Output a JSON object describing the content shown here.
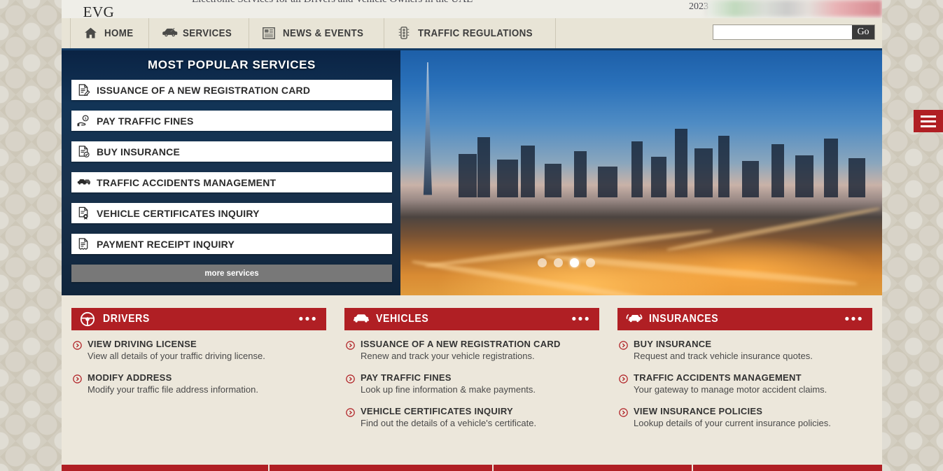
{
  "site": {
    "logo_text": "EVG",
    "tagline": "Electronic Services for all Drivers and Vehicle Owners in the UAE",
    "year": "2023"
  },
  "nav": {
    "items": [
      {
        "label": "HOME",
        "icon": "home-icon"
      },
      {
        "label": "SERVICES",
        "icon": "car-icon"
      },
      {
        "label": "NEWS & EVENTS",
        "icon": "newspaper-icon"
      },
      {
        "label": "TRAFFIC REGULATIONS",
        "icon": "traffic-light-icon"
      }
    ]
  },
  "search": {
    "value": "",
    "placeholder": "",
    "button_label": "Go"
  },
  "popular": {
    "title": "MOST POPULAR SERVICES",
    "items": [
      {
        "label": "ISSUANCE OF A NEW REGISTRATION CARD",
        "icon": "document-edit-icon"
      },
      {
        "label": "PAY TRAFFIC FINES",
        "icon": "hand-coin-icon"
      },
      {
        "label": "BUY INSURANCE",
        "icon": "document-check-icon"
      },
      {
        "label": "TRAFFIC ACCIDENTS MANAGEMENT",
        "icon": "car-collision-icon"
      },
      {
        "label": "VEHICLE CERTIFICATES INQUIRY",
        "icon": "certificate-icon"
      },
      {
        "label": "PAYMENT RECEIPT INQUIRY",
        "icon": "receipt-icon"
      }
    ],
    "more_label": "more services"
  },
  "carousel": {
    "slide_count": 4,
    "active_index": 2
  },
  "side_tab": {
    "icon": "hamburger-menu-icon"
  },
  "cards": [
    {
      "title": "DRIVERS",
      "icon": "steering-wheel-icon",
      "menu_icon": "ellipsis-icon",
      "items": [
        {
          "title": "VIEW DRIVING LICENSE",
          "desc": "View all details of your traffic driving license."
        },
        {
          "title": "MODIFY ADDRESS",
          "desc": "Modify your traffic file address information."
        }
      ]
    },
    {
      "title": "VEHICLES",
      "icon": "car-front-icon",
      "menu_icon": "ellipsis-icon",
      "items": [
        {
          "title": "ISSUANCE OF A NEW REGISTRATION CARD",
          "desc": "Renew and track your vehicle registrations."
        },
        {
          "title": "PAY TRAFFIC FINES",
          "desc": "Look up fine information & make payments."
        },
        {
          "title": "VEHICLE CERTIFICATES INQUIRY",
          "desc": "Find out the details of a vehicle's certificate."
        }
      ]
    },
    {
      "title": "INSURANCES",
      "icon": "car-shield-icon",
      "menu_icon": "ellipsis-icon",
      "items": [
        {
          "title": "BUY INSURANCE",
          "desc": "Request and track vehicle insurance quotes."
        },
        {
          "title": "TRAFFIC ACCIDENTS MANAGEMENT",
          "desc": "Your gateway to manage motor accident claims."
        },
        {
          "title": "VIEW INSURANCE POLICIES",
          "desc": "Lookup details of your current insurance policies."
        }
      ]
    }
  ],
  "colors": {
    "brand_red": "#b01f24",
    "nav_bg": "#e8e4d6",
    "panel_blue": "#123456",
    "card_bg": "#ece7db",
    "page_bg": "#cdc7b8"
  }
}
